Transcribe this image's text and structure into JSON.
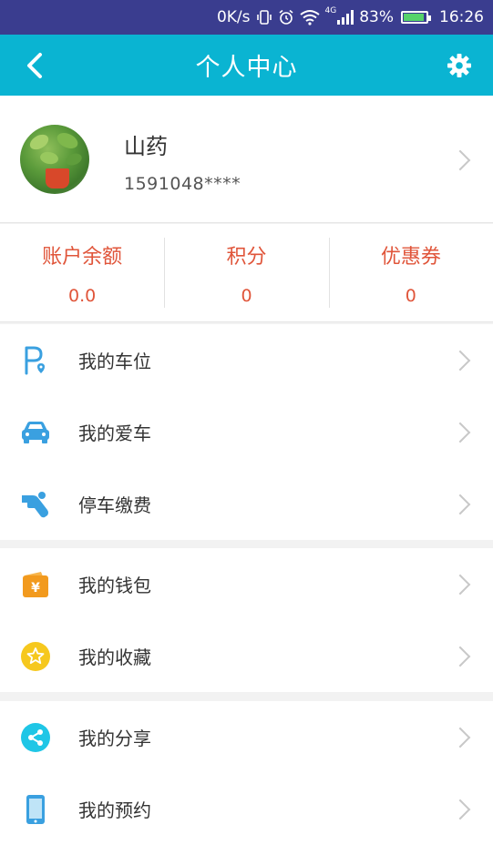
{
  "status_bar": {
    "speed": "0K/s",
    "network": "4G",
    "battery": "83%",
    "time": "16:26"
  },
  "header": {
    "title": "个人中心",
    "back_icon": "back-arrow-icon",
    "settings_icon": "gear-icon"
  },
  "profile": {
    "name": "山药",
    "phone": "1591048****"
  },
  "stats": [
    {
      "label": "账户余额",
      "value": "0.0"
    },
    {
      "label": "积分",
      "value": "0"
    },
    {
      "label": "优惠券",
      "value": "0"
    }
  ],
  "menu": {
    "group1": [
      {
        "label": "我的车位",
        "icon": "parking-location-icon"
      },
      {
        "label": "我的爱车",
        "icon": "car-icon"
      },
      {
        "label": "停车缴费",
        "icon": "payment-hand-icon"
      }
    ],
    "group2": [
      {
        "label": "我的钱包",
        "icon": "wallet-icon"
      },
      {
        "label": "我的收藏",
        "icon": "star-icon"
      }
    ],
    "group3": [
      {
        "label": "我的分享",
        "icon": "share-icon"
      },
      {
        "label": "我的预约",
        "icon": "phone-reservation-icon"
      }
    ]
  },
  "colors": {
    "status_bar": "#3a3d8f",
    "header": "#0ab4d2",
    "accent_red": "#e0553a",
    "icon_blue": "#3aa0e0",
    "wallet_orange": "#f29a1e",
    "star_yellow": "#f6c81e",
    "share_cyan": "#1fc6e6"
  }
}
